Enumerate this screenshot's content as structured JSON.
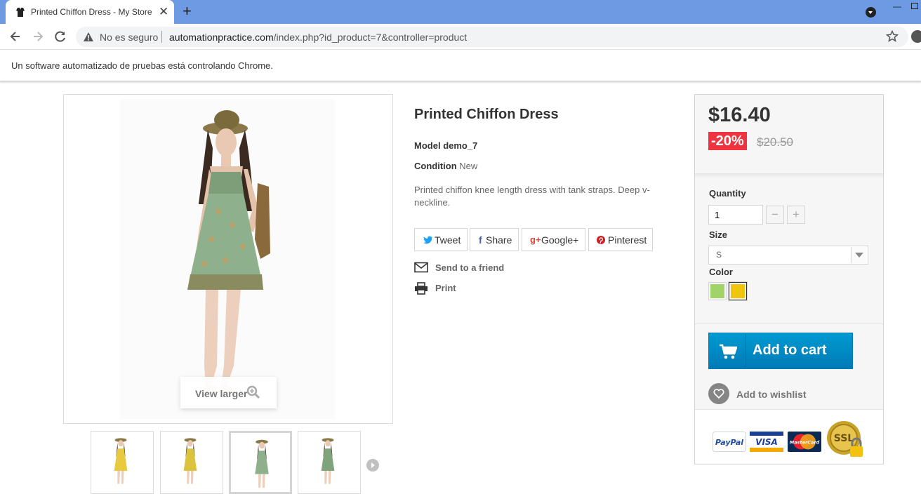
{
  "browser": {
    "tab_title": "Printed Chiffon Dress - My Store",
    "not_secure": "No es seguro",
    "url_domain": "automationpractice.com",
    "url_path": "/index.php?id_product=7&controller=product",
    "infobar": "Un software automatizado de pruebas está controlando Chrome."
  },
  "gallery": {
    "view_larger": "View larger",
    "thumbnails": [
      {
        "dress_color": "#e9c93f"
      },
      {
        "dress_color": "#dcc33e"
      },
      {
        "dress_color": "#8fb08d",
        "active": true
      },
      {
        "dress_color": "#7fa37a"
      }
    ]
  },
  "product": {
    "name": "Printed Chiffon Dress",
    "model_label": "Model",
    "model_value": "demo_7",
    "condition_label": "Condition",
    "condition_value": "New",
    "description": "Printed chiffon knee length dress with tank straps. Deep v-neckline.",
    "social": {
      "tweet": "Tweet",
      "share": "Share",
      "google": "Google+",
      "pinterest": "Pinterest"
    },
    "send_to_friend": "Send to a friend",
    "print": "Print"
  },
  "buybox": {
    "price": "$16.40",
    "discount": "-20%",
    "old_price": "$20.50",
    "quantity_label": "Quantity",
    "quantity_value": "1",
    "size_label": "Size",
    "size_value": "S",
    "color_label": "Color",
    "colors": [
      "#a0d468",
      "#f1c40f"
    ],
    "selected_color": "#f1c40f",
    "add_to_cart": "Add to cart",
    "add_to_wishlist": "Add to wishlist",
    "payment_logos": [
      "PayPal",
      "VISA",
      "MasterCard",
      "SSL"
    ]
  },
  "colors": {
    "tabbar": "#6e9ae4",
    "cart_blue": "#009ad0",
    "discount_red": "#f13340"
  }
}
